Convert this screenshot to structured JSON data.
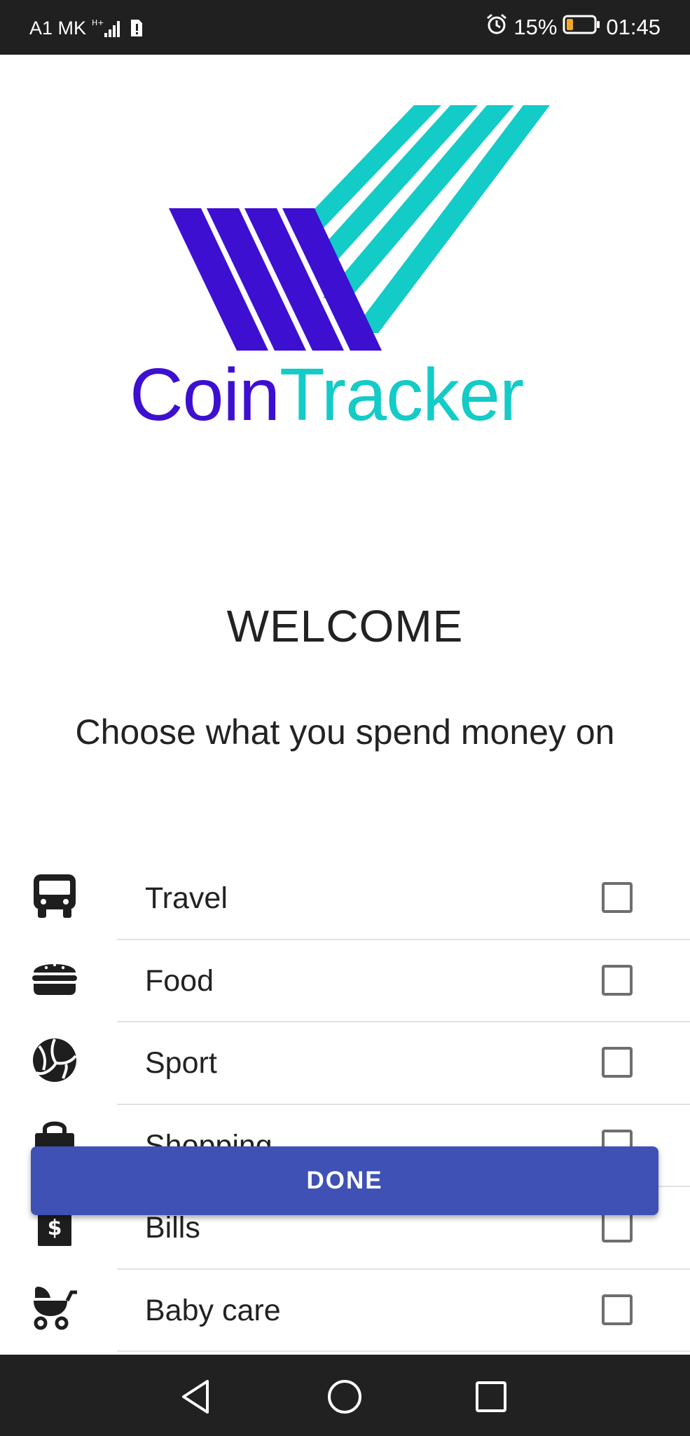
{
  "status_bar": {
    "carrier": "A1 MK",
    "network_type": "H+",
    "battery_percent": "15%",
    "time": "01:45",
    "icons": [
      "signal-icon",
      "sim-alert-icon",
      "alarm-icon",
      "battery-icon"
    ]
  },
  "logo": {
    "word_coin": "Coin",
    "word_tracker": "Tracker",
    "colors": {
      "coin": "#3d0fd1",
      "tracker": "#13cbc7"
    }
  },
  "welcome_title": "WELCOME",
  "subtitle": "Choose what you spend money on",
  "categories": [
    {
      "label": "Travel",
      "icon": "bus-icon",
      "checked": false
    },
    {
      "label": "Food",
      "icon": "burger-icon",
      "checked": false
    },
    {
      "label": "Sport",
      "icon": "volleyball-icon",
      "checked": false
    },
    {
      "label": "Shopping",
      "icon": "shopping-bag-icon",
      "checked": false
    },
    {
      "label": "Bills",
      "icon": "bill-icon",
      "checked": false
    },
    {
      "label": "Baby care",
      "icon": "stroller-icon",
      "checked": false
    }
  ],
  "done_button": {
    "label": "DONE",
    "color": "#3f51b5"
  },
  "nav_bar": {
    "buttons": [
      "back-icon",
      "home-icon",
      "recents-icon"
    ]
  }
}
